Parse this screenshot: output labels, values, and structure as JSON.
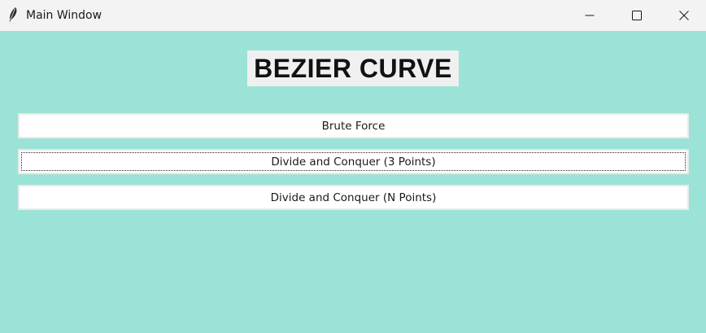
{
  "window": {
    "title": "Main Window",
    "app_icon": "feather-icon",
    "controls": {
      "minimize_icon": "minimize-icon",
      "maximize_icon": "maximize-icon",
      "close_icon": "close-icon"
    }
  },
  "main": {
    "heading": "BEZIER CURVE",
    "buttons": [
      {
        "label": "Brute Force"
      },
      {
        "label": "Divide and Conquer (3 Points)"
      },
      {
        "label": "Divide and Conquer (N Points)"
      }
    ]
  },
  "colors": {
    "background": "#9be3d6",
    "titlebar": "#f3f3f3",
    "heading_bg": "#f0f0f0",
    "button_bg": "#ffffff"
  }
}
